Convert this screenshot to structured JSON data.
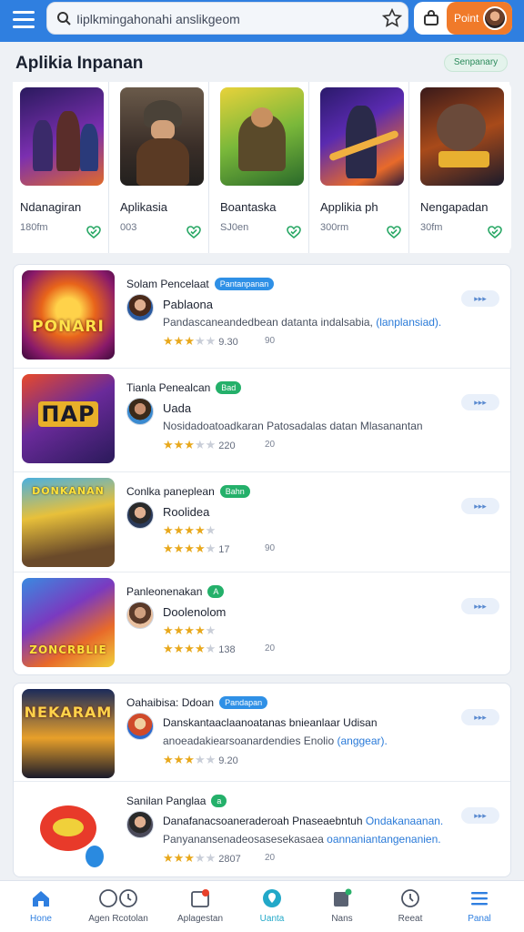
{
  "header": {
    "search_text": "Iiplkmingahonahi anslikgeom",
    "point_label": "Point"
  },
  "section": {
    "title": "Aplikia Inpanan",
    "chip": "Senpanary"
  },
  "featured": [
    {
      "name": "Ndanagiran",
      "meta": "180fm"
    },
    {
      "name": "Aplikasia",
      "meta": "003"
    },
    {
      "name": "Boantaska",
      "meta": "SJ0en"
    },
    {
      "name": "Applikia ph",
      "meta": "300rm"
    },
    {
      "name": "Nengapadan",
      "meta": "30fm"
    }
  ],
  "list": [
    {
      "title": "Solam Pencelaat",
      "badge": "Pantanpanan",
      "sub": "Pablaona",
      "desc": "Pandascaneandedbean datanta indalsabia, ",
      "desc_link": "(lanplansiad).",
      "rating": "9.30",
      "count": "90",
      "thumb_text": "PONARI",
      "more": "▸▸▸"
    },
    {
      "title": "Tianla  Penealcan",
      "badge": "Bad",
      "sub": "Uada",
      "desc": "Nosidadoatoadkaran  Patosadalas datan Mlasanantan",
      "desc_link": "",
      "rating": "220",
      "count": "20",
      "thumb_text": "ПАР",
      "more": "▸▸▸"
    },
    {
      "title": "Conlka paneplean",
      "badge": "Bahn",
      "sub": "Roolidea",
      "desc": "",
      "desc_link": "",
      "rating": "17",
      "count": "90",
      "thumb_text": "DONKANAN",
      "more": "▸▸▸"
    },
    {
      "title": "Panleonenakan",
      "badge": "A",
      "sub": "Doolenolom",
      "desc": "",
      "desc_link": "",
      "rating": "138",
      "count": "20",
      "thumb_text": "ZONCRBLIE",
      "more": "▸▸▸"
    },
    {
      "title": "Oahaibisa: Ddoan",
      "badge": "Pandapan",
      "sub": "Danskantaaclaanoatanas bnieanlaar  Udisan",
      "desc": "anoeadakiearsoanardendies Enolio ",
      "desc_link": "(anggear).",
      "rating": "9.20",
      "count": "",
      "thumb_text": "NEKARAM",
      "more": "▸▸▸"
    },
    {
      "title": "Sanilan Panglaa",
      "badge": "a",
      "sub": "Danafanacsoaneraderoah Pnaseaebntuh  ",
      "sub_link": "Ondakanaanan.",
      "desc": "Panyanansenadeosasesekasaea  ",
      "desc_link": "oannaniantangenanien.",
      "rating": "2807",
      "count": "20",
      "thumb_text": "",
      "more": "▸▸▸"
    }
  ],
  "nav": [
    {
      "label": "Hone"
    },
    {
      "label": "Agen Rcotolan"
    },
    {
      "label": "Aplagestan"
    },
    {
      "label": "Uanta"
    },
    {
      "label": "Nans"
    },
    {
      "label": "Reeat"
    },
    {
      "label": "Panal"
    }
  ]
}
